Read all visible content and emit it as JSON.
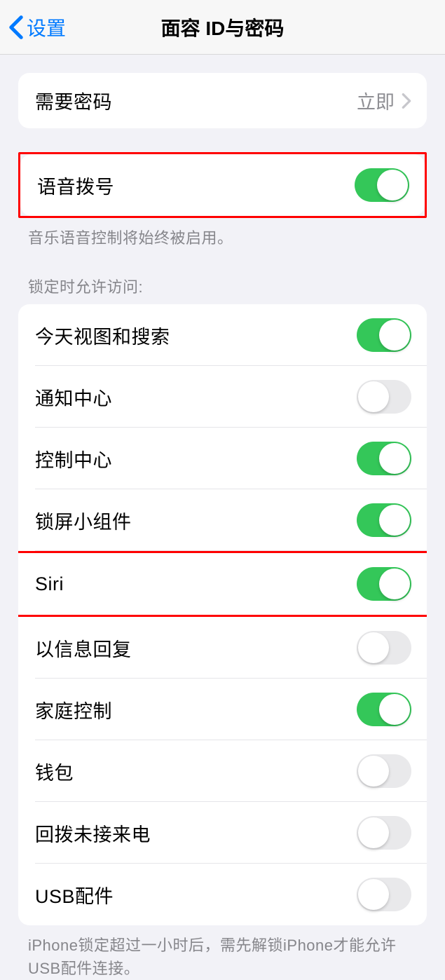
{
  "nav": {
    "back_label": "设置",
    "title": "面容 ID与密码"
  },
  "passcode_group": {
    "require_passcode_label": "需要密码",
    "require_passcode_value": "立即"
  },
  "voice_dial": {
    "label": "语音拨号",
    "on": true,
    "footer": "音乐语音控制将始终被启用。"
  },
  "lock_access": {
    "header": "锁定时允许访问:",
    "items": [
      {
        "label": "今天视图和搜索",
        "on": true
      },
      {
        "label": "通知中心",
        "on": false
      },
      {
        "label": "控制中心",
        "on": true
      },
      {
        "label": "锁屏小组件",
        "on": true
      },
      {
        "label": "Siri",
        "on": true
      },
      {
        "label": "以信息回复",
        "on": false
      },
      {
        "label": "家庭控制",
        "on": true
      },
      {
        "label": "钱包",
        "on": false
      },
      {
        "label": "回拨未接来电",
        "on": false
      },
      {
        "label": "USB配件",
        "on": false
      }
    ],
    "footer": "iPhone锁定超过一小时后，需先解锁iPhone才能允许USB配件连接。"
  }
}
